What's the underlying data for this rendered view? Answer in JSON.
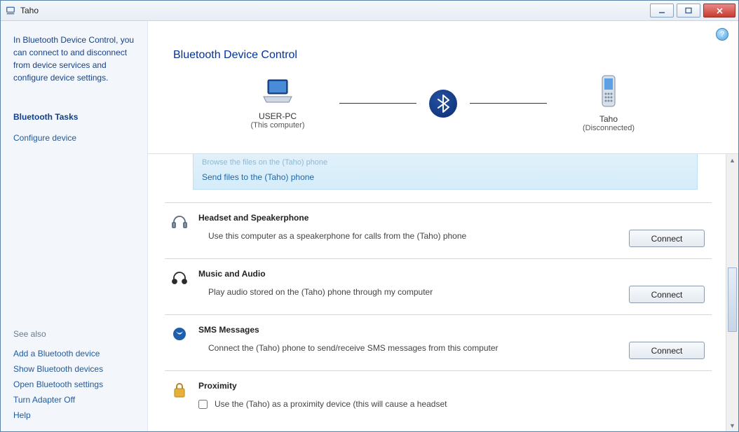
{
  "title": "Taho",
  "sidebar": {
    "intro": "In Bluetooth Device Control, you can connect to and disconnect from device services and configure device settings.",
    "tasks_head": "Bluetooth Tasks",
    "configure": "Configure device",
    "see_also_head": "See also",
    "see_also": {
      "add": "Add a Bluetooth device",
      "show": "Show Bluetooth devices",
      "open": "Open Bluetooth settings",
      "turn_off": "Turn Adapter Off",
      "help": "Help"
    }
  },
  "main": {
    "page_title": "Bluetooth Device Control",
    "pc": {
      "name": "USER-PC",
      "sub": "(This computer)"
    },
    "phone": {
      "name": "Taho",
      "sub": "(Disconnected)"
    },
    "trunc": {
      "ghost": "Browse the files on the (Taho) phone",
      "send": "Send files to the (Taho) phone"
    },
    "services": {
      "headset": {
        "title": "Headset and Speakerphone",
        "desc": "Use this computer as a speakerphone for calls from the (Taho) phone",
        "btn": "Connect"
      },
      "audio": {
        "title": "Music and Audio",
        "desc": "Play audio stored on the (Taho) phone through my computer",
        "btn": "Connect"
      },
      "sms": {
        "title": "SMS Messages",
        "desc": "Connect the (Taho) phone to send/receive SMS messages from this computer",
        "btn": "Connect"
      },
      "proximity": {
        "title": "Proximity",
        "desc": "Use the (Taho) as a proximity device (this will cause a headset"
      }
    }
  }
}
